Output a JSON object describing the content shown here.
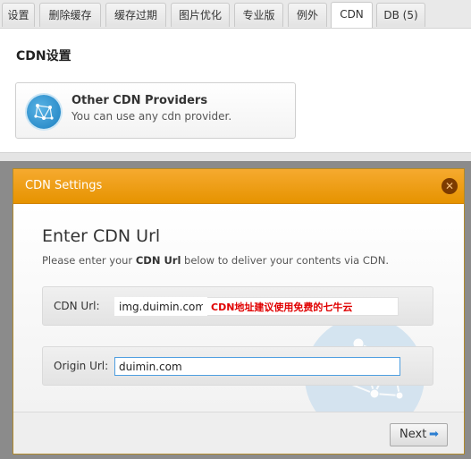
{
  "tabs": [
    {
      "label": "设置"
    },
    {
      "label": "删除缓存"
    },
    {
      "label": "缓存过期"
    },
    {
      "label": "图片优化"
    },
    {
      "label": "专业版"
    },
    {
      "label": "例外"
    },
    {
      "label": "CDN",
      "active": true
    },
    {
      "label": "DB (5)"
    }
  ],
  "section": {
    "title": "CDN设置"
  },
  "provider": {
    "name": "Other CDN Providers",
    "description": "You can use any cdn provider.",
    "icon": "network-icon"
  },
  "modal": {
    "title": "CDN Settings",
    "close_icon": "close-icon",
    "heading": "Enter CDN Url",
    "desc_pre": "Please enter your ",
    "desc_bold": "CDN Url",
    "desc_post": " below to deliver your contents via CDN.",
    "cdn_url": {
      "label": "CDN Url:",
      "value": "img.duimin.com"
    },
    "hint": "CDN地址建议使用免费的七牛云",
    "origin_url": {
      "label": "Origin Url:",
      "value": "duimin.com"
    },
    "next_label": "Next",
    "next_icon": "arrow-right-icon"
  },
  "colors": {
    "header_orange": "#f0a018",
    "hint_red": "#e00000",
    "accent_blue": "#2d7fd1"
  }
}
